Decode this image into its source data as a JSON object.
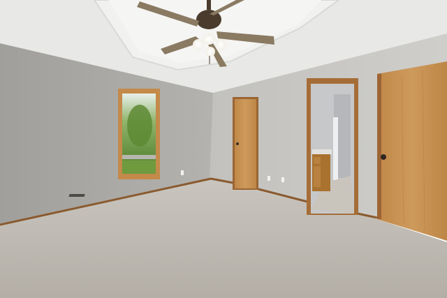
{
  "scene": {
    "description_kind": "photograph",
    "room": "empty bedroom",
    "colors": {
      "ceiling": "#e9e9e7",
      "wall_left": "#a8a7a3",
      "wall_back": "#bdbcb8",
      "wall_right": "#c6c5c1",
      "carpet": "#bdb8b0",
      "wood": "#c48f4e",
      "trim": "#8a5a2e",
      "window_green": "#6f9a3e",
      "fan_metal": "#4a3b2c",
      "fan_blade": "#8a7a62"
    }
  }
}
